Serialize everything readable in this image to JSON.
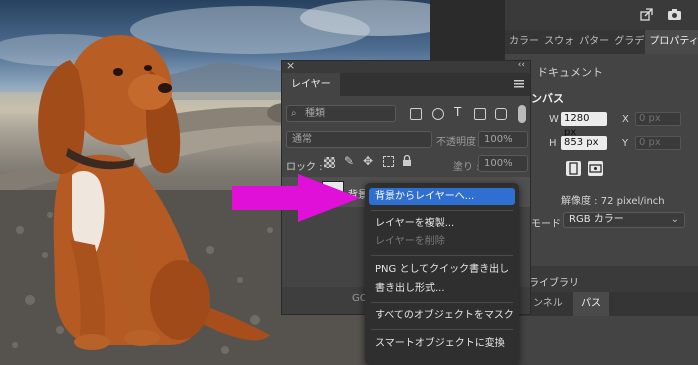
{
  "layers_panel": {
    "close_glyph": "×",
    "collapse_glyph": "‹‹",
    "tab_label": "レイヤー",
    "filter_label": "種類",
    "blend_mode": "通常",
    "opacity_label": "不透明度 :",
    "opacity_value": "100%",
    "lock_label": "ロック :",
    "fill_label": "塗り :",
    "fill_value": "100%",
    "layer_name_partial": "背景",
    "bottom_partial": "GO"
  },
  "context_menu": {
    "items": [
      {
        "label": "背景からレイヤーへ...",
        "state": "highlighted"
      },
      {
        "label": "レイヤーを複製...",
        "state": "enabled"
      },
      {
        "label": "レイヤーを削除",
        "state": "disabled"
      },
      {
        "label": "PNG としてクイック書き出し",
        "state": "enabled"
      },
      {
        "label": "書き出し形式...",
        "state": "enabled"
      },
      {
        "label": "すべてのオブジェクトをマスク",
        "state": "enabled"
      },
      {
        "label": "スマートオブジェクトに変換",
        "state": "enabled"
      }
    ]
  },
  "properties_panel": {
    "tabs": [
      "カラー",
      "スウォ",
      "パター",
      "グラデ",
      "プロパティ"
    ],
    "active_tab": "プロパティ",
    "section_document": "ドキュメント",
    "section_canvas": "ンバス",
    "w_label": "W",
    "w_value": "1280 px",
    "h_label": "H",
    "h_value": "853 px",
    "x_label": "X",
    "x_placeholder": "0 px",
    "y_label": "Y",
    "y_placeholder": "0 px",
    "resolution": "解像度 : 72 pixel/inch",
    "mode_label": "モード",
    "mode_value": "RGB カラー",
    "library_tab": "ライブラリ",
    "channels_tab": "ンネル",
    "paths_tab": "パス"
  },
  "colors": {
    "arrow": "#e010d8",
    "menu_highlight": "#2f6fd2",
    "panel_bg": "#444444"
  }
}
